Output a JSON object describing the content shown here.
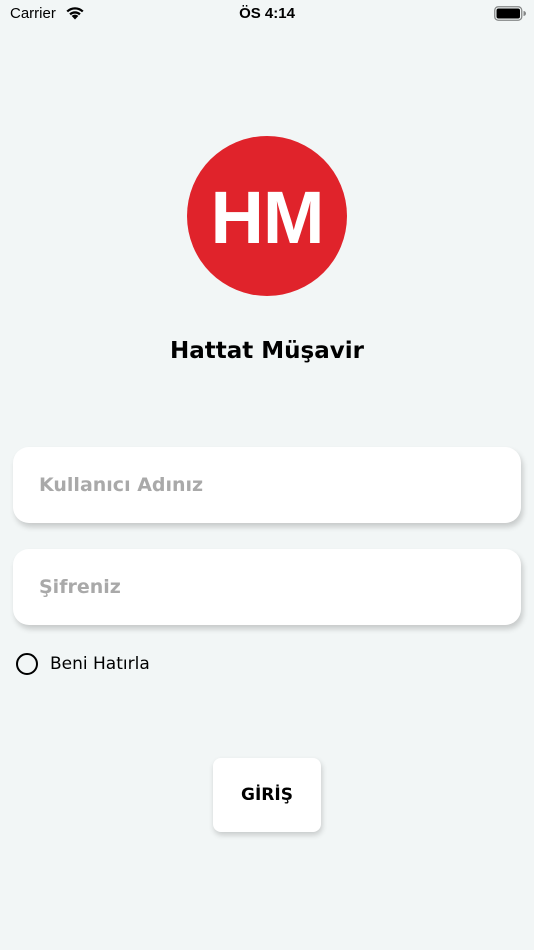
{
  "status_bar": {
    "carrier": "Carrier",
    "time": "ÖS 4:14",
    "icons": [
      "wifi-icon",
      "battery-icon"
    ]
  },
  "logo": {
    "text": "HM",
    "color": "#e0232b"
  },
  "app": {
    "name": "Hattat Müşavir"
  },
  "login_form": {
    "username": {
      "placeholder": "Kullanıcı Adınız",
      "value": ""
    },
    "password": {
      "placeholder": "Şifreniz",
      "value": ""
    },
    "remember_me": {
      "label": "Beni Hatırla",
      "checked": false
    },
    "submit_label": "GİRİŞ"
  },
  "colors": {
    "background": "#f2f6f6",
    "field_background": "#ffffff",
    "placeholder": "#a9a9a9"
  }
}
